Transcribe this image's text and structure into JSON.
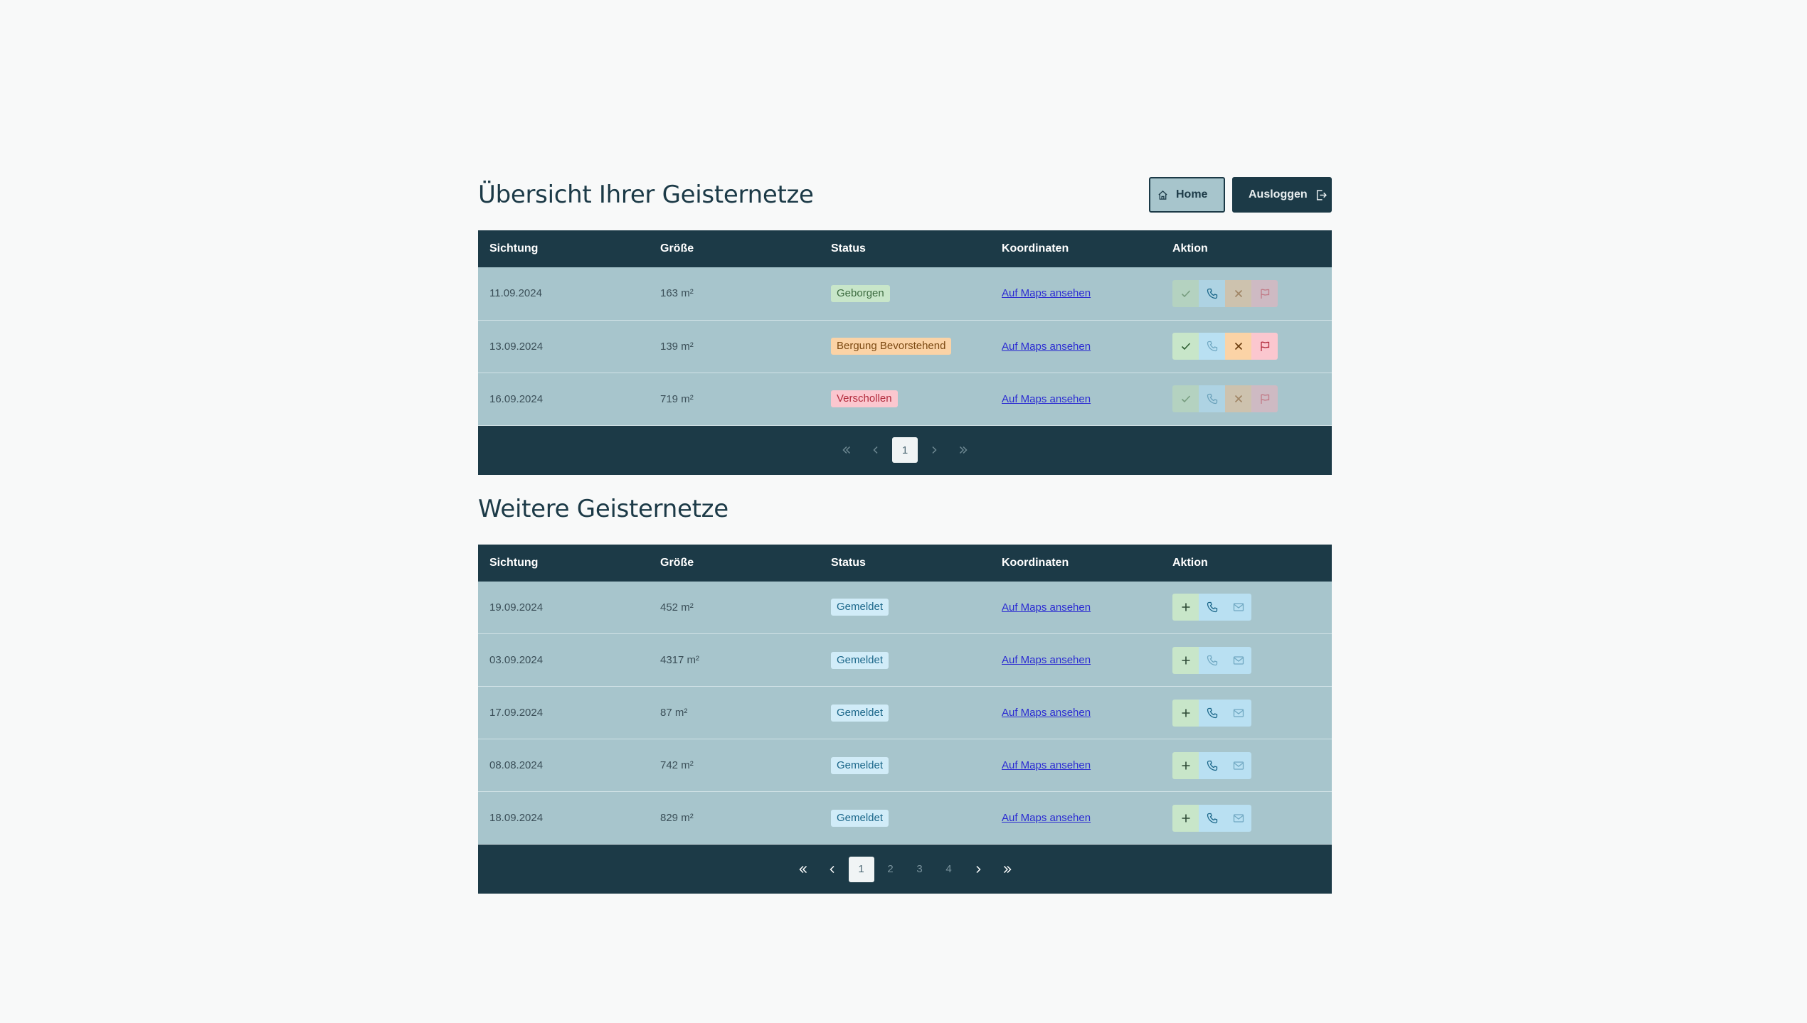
{
  "header": {
    "title": "Übersicht Ihrer Geisternetze",
    "home_label": "Home",
    "logout_label": "Ausloggen"
  },
  "columns": [
    "Sichtung",
    "Größe",
    "Status",
    "Koordinaten",
    "Aktion"
  ],
  "own_nets": {
    "rows": [
      {
        "date": "11.09.2024",
        "size": "163 m²",
        "status": "Geborgen",
        "status_kind": "geborgen",
        "link": "Auf Maps ansehen",
        "actions_faded": true
      },
      {
        "date": "13.09.2024",
        "size": "139 m²",
        "status": "Bergung Bevorstehend",
        "status_kind": "bergung",
        "link": "Auf Maps ansehen",
        "actions_faded": false
      },
      {
        "date": "16.09.2024",
        "size": "719 m²",
        "status": "Verschollen",
        "status_kind": "verschollen",
        "link": "Auf Maps ansehen",
        "actions_faded": true
      }
    ],
    "pagination": {
      "current": "1"
    }
  },
  "other_nets": {
    "title": "Weitere Geisternetze",
    "rows": [
      {
        "date": "19.09.2024",
        "size": "452 m²",
        "status": "Gemeldet",
        "link": "Auf Maps ansehen",
        "call_enabled": true
      },
      {
        "date": "03.09.2024",
        "size": "4317 m²",
        "status": "Gemeldet",
        "link": "Auf Maps ansehen",
        "call_enabled": false
      },
      {
        "date": "17.09.2024",
        "size": "87 m²",
        "status": "Gemeldet",
        "link": "Auf Maps ansehen",
        "call_enabled": true
      },
      {
        "date": "08.08.2024",
        "size": "742 m²",
        "status": "Gemeldet",
        "link": "Auf Maps ansehen",
        "call_enabled": true
      },
      {
        "date": "18.09.2024",
        "size": "829 m²",
        "status": "Gemeldet",
        "link": "Auf Maps ansehen",
        "call_enabled": true
      }
    ],
    "pagination": {
      "current": "1",
      "pages": [
        "1",
        "2",
        "3",
        "4"
      ]
    }
  },
  "colors": {
    "primary": "#1c3a47",
    "row_bg": "#a7c5cc",
    "page_bg": "#f8f9f9",
    "link": "#2b2bd2"
  }
}
